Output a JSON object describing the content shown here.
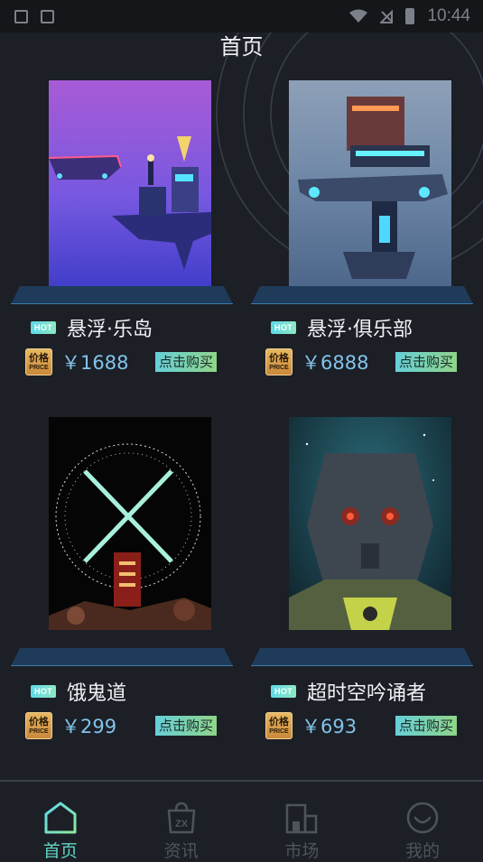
{
  "status_bar": {
    "time": "10:44"
  },
  "header": {
    "title": "首页"
  },
  "products": [
    {
      "name": "悬浮·乐岛",
      "price": "￥1688",
      "hot": "HOT",
      "buy_label": "点击购买",
      "price_icon_top": "价格",
      "price_icon_bottom": "PRICE"
    },
    {
      "name": "悬浮·俱乐部",
      "price": "￥6888",
      "hot": "HOT",
      "buy_label": "点击购买",
      "price_icon_top": "价格",
      "price_icon_bottom": "PRICE"
    },
    {
      "name": "饿鬼道",
      "price": "￥299",
      "hot": "HOT",
      "buy_label": "点击购买",
      "price_icon_top": "价格",
      "price_icon_bottom": "PRICE"
    },
    {
      "name": "超时空吟诵者",
      "price": "￥693",
      "hot": "HOT",
      "buy_label": "点击购买",
      "price_icon_top": "价格",
      "price_icon_bottom": "PRICE"
    }
  ],
  "bottom_nav": [
    {
      "label": "首页",
      "icon": "home-icon",
      "active": true
    },
    {
      "label": "资讯",
      "icon": "news-bag-icon",
      "active": false
    },
    {
      "label": "市场",
      "icon": "market-icon",
      "active": false
    },
    {
      "label": "我的",
      "icon": "smile-icon",
      "active": false
    }
  ],
  "colors": {
    "background": "#1c1f26",
    "accent": "#62d3c2",
    "price": "#82c3ea"
  }
}
